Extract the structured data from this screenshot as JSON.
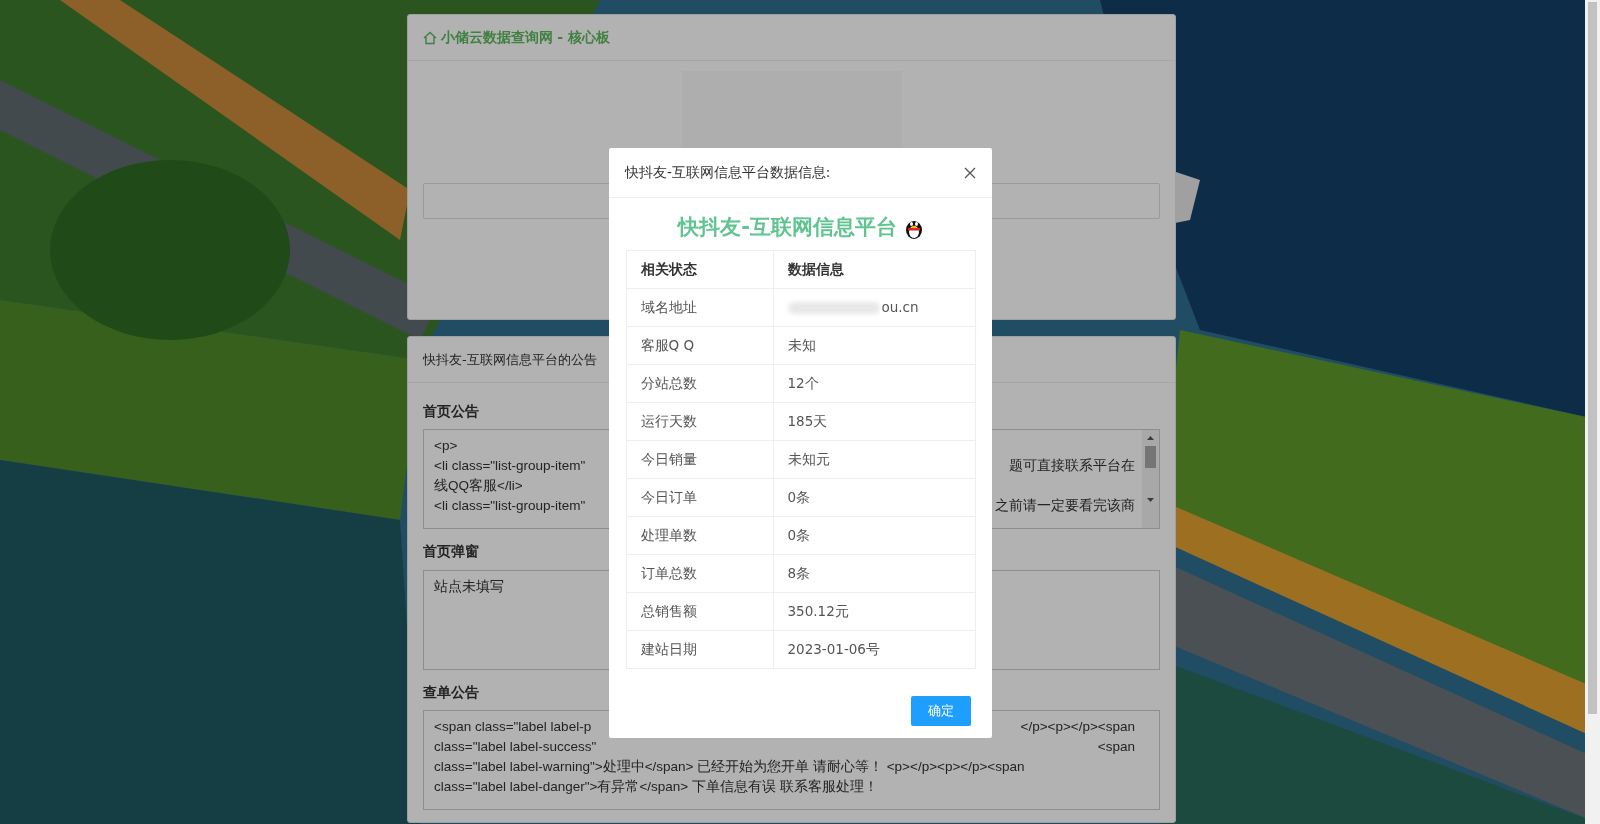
{
  "header_card": {
    "title": "小储云数据查询网 - 核心板"
  },
  "notice_card": {
    "title": "快抖友-互联网信息平台的公告",
    "sections": [
      {
        "label": "首页公告",
        "scrollable": true,
        "lines": [
          {
            "left": "<p>"
          },
          {
            "left": "<li class=\"list-group-item\"",
            "right": "题可直接联系平台在"
          },
          {
            "left": "线QQ客服</li>"
          },
          {
            "left": "<li class=\"list-group-item\"",
            "right": "之前请一定要看完该商"
          }
        ]
      },
      {
        "label": "首页弹窗",
        "scrollable": false,
        "lines": [
          {
            "left": "站点未填写"
          }
        ]
      },
      {
        "label": "查单公告",
        "scrollable": false,
        "lines": [
          {
            "left": "<span class=\"label label-p",
            "right": "</p><p></p><span"
          },
          {
            "left": "class=\"label label-success\"",
            "right": "<span"
          },
          {
            "left": "class=\"label label-warning\">处理中</span> 已经开始为您开单 请耐心等！ <p></p><p></p><span"
          },
          {
            "left": "class=\"label label-danger\">有异常</span> 下单信息有误 联系客服处理！"
          }
        ]
      }
    ]
  },
  "modal": {
    "title": "快抖友-互联网信息平台数据信息:",
    "heading": "快抖友-互联网信息平台",
    "columns": [
      "相关状态",
      "数据信息"
    ],
    "rows": [
      {
        "label": "域名地址",
        "value": "ou.cn",
        "redacted": true
      },
      {
        "label": "客服Q Q",
        "value": "未知"
      },
      {
        "label": "分站总数",
        "value": "12个"
      },
      {
        "label": "运行天数",
        "value": "185天"
      },
      {
        "label": "今日销量",
        "value": "未知元"
      },
      {
        "label": "今日订单",
        "value": "0条"
      },
      {
        "label": "处理单数",
        "value": "0条"
      },
      {
        "label": "订单总数",
        "value": "8条"
      },
      {
        "label": "总销售额",
        "value": "350.12元"
      },
      {
        "label": "建站日期",
        "value": "2023-01-06号"
      }
    ],
    "button": "确定"
  }
}
